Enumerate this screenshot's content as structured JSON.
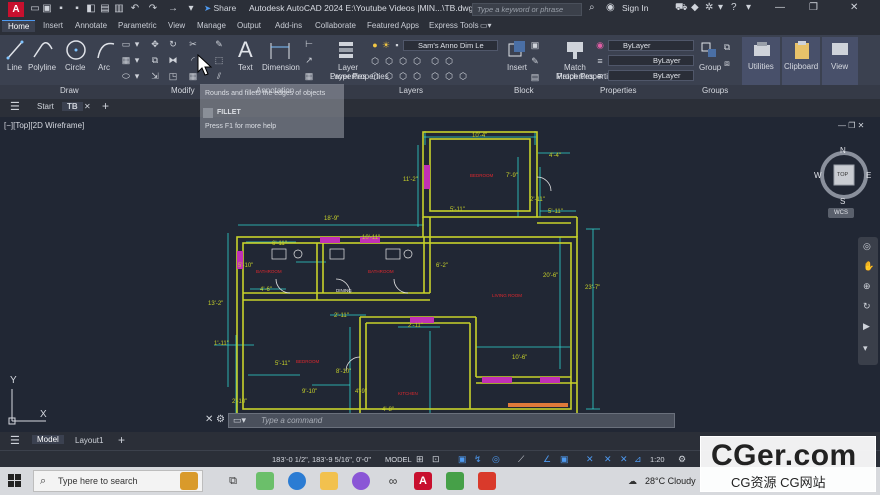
{
  "titlebar": {
    "app_letter": "A",
    "share_label": "Share",
    "title": "Autodesk AutoCAD 2024   E:\\Youtube Videos |MIN...\\TB.dwg",
    "search_placeholder": "Type a keyword or phrase",
    "signin_label": "Sign In"
  },
  "tabs": [
    "Home",
    "Insert",
    "Annotate",
    "Parametric",
    "View",
    "Manage",
    "Output",
    "Add-ins",
    "Collaborate",
    "Featured Apps",
    "Express Tools"
  ],
  "ribbon": {
    "draw": {
      "line": "Line",
      "polyline": "Polyline",
      "circle": "Circle",
      "arc": "Arc",
      "panel": "Draw"
    },
    "modify": {
      "panel": "Modify"
    },
    "annotation": {
      "text": "Text",
      "dimension": "Dimension",
      "panel": "Annotation"
    },
    "layers": {
      "layer_properties": "Layer Properties",
      "current_layer": "Sam's Anno Dim Le",
      "panel": "Layers"
    },
    "block": {
      "insert": "Insert",
      "panel": "Block"
    },
    "properties": {
      "match": "Match Properties",
      "bylayer1": "ByLayer",
      "bylayer2": "ByLayer",
      "bylayer3": "ByLayer",
      "panel": "Properties"
    },
    "groups": {
      "group": "Group",
      "panel": "Groups"
    },
    "utilities": "Utilities",
    "clipboard": "Clipboard",
    "view": "View"
  },
  "tooltip": {
    "title": "FILLET",
    "line1": "Rounds and fillets the edges of objects",
    "help": "Press F1 for more help"
  },
  "doctabs": {
    "start": "Start",
    "file": "TB"
  },
  "viewport": {
    "label": "[−][Top][2D Wireframe]",
    "compass_n": "N",
    "compass_s": "S",
    "compass_e": "E",
    "compass_w": "W",
    "compass_top": "TOP",
    "ucs": "WCS",
    "axis_y": "Y",
    "axis_x": "X"
  },
  "plan": {
    "dims": [
      "10'-4\"",
      "11'-2\"",
      "7'-9\"",
      "5'-11\"",
      "4'-4\"",
      "2'-11\"",
      "5'-11\"",
      "18'-9\"",
      "10'-11\"",
      "6'-11\"",
      "5'-10\"",
      "4'-6\"",
      "6'-2\"",
      "20'-6\"",
      "23'-7\"",
      "13'-2\"",
      "2'-11\"",
      "2'-11\"",
      "1'-11\"",
      "10'-6\"",
      "5'-11\"",
      "8'-10\"",
      "9'-10\"",
      "4'-9\"",
      "4'-8\"",
      "2'-10\""
    ],
    "rooms": [
      "BEDROOM",
      "BATHROOM",
      "BATHROOM",
      "LIVING ROOM",
      "BEDROOM",
      "KITCHEN",
      "DINING"
    ]
  },
  "cmdline": {
    "placeholder": "Type a command"
  },
  "layout": {
    "model": "Model",
    "layout1": "Layout1"
  },
  "statusbar": {
    "coords": "183'-0 1/2\", 183'-9 5/16\", 0'-0\"",
    "model": "MODEL",
    "scale": "1:20"
  },
  "taskbar": {
    "search": "Type here to search",
    "weather": "28°C  Cloudy"
  },
  "watermark": {
    "title": "CGer.com",
    "sub": "CG资源 CG网站"
  }
}
